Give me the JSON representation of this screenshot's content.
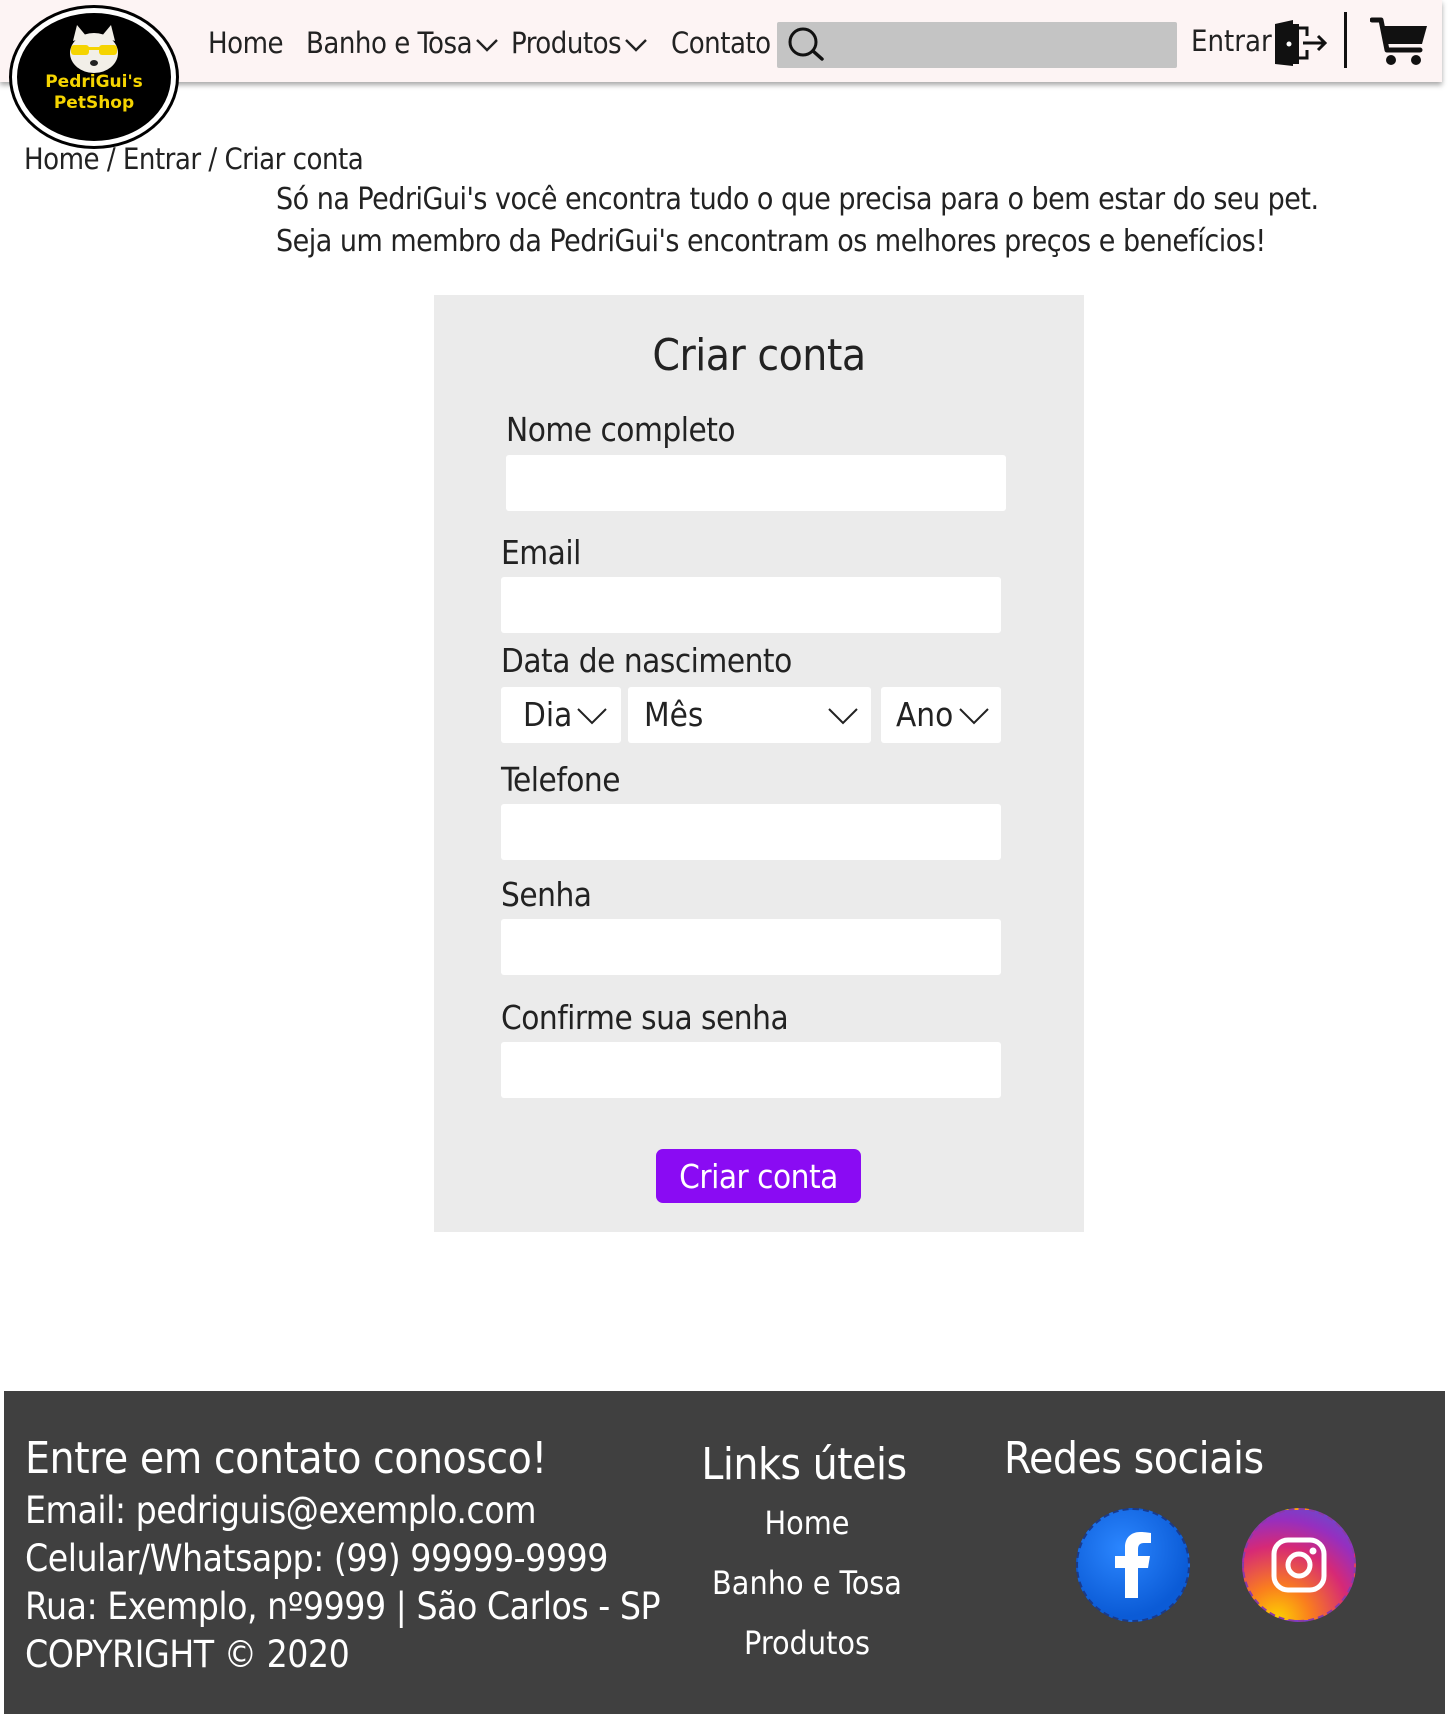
{
  "header": {
    "logo_line1": "PedriGui's",
    "logo_line2": "PetShop",
    "nav": [
      "Home",
      "Banho e Tosa",
      "Produtos",
      "Contato"
    ],
    "search_placeholder": "",
    "login_label": "Entrar",
    "icons": {
      "search": "search-icon",
      "login": "door-exit-icon",
      "cart": "cart-icon",
      "dropdown": "chevron-down-icon"
    }
  },
  "breadcrumb": "Home / Entrar / Criar conta",
  "intro": [
    "Só na PedriGui's você encontra tudo o que precisa para o bem estar do seu pet.",
    "Seja um membro da PedriGui's encontram os melhores preços e benefícios!"
  ],
  "form": {
    "title": "Criar conta",
    "full_name_label": "Nome completo",
    "email_label": "Email",
    "birth_label": "Data de nascimento",
    "day": "Dia",
    "month": "Mês",
    "year": "Ano",
    "phone_label": "Telefone",
    "password_label": "Senha",
    "confirm_label": "Confirme sua senha",
    "submit_label": "Criar conta"
  },
  "footer": {
    "contact_title": "Entre em contato conosco!",
    "contact_lines": [
      "Email: pedriguis@exemplo.com",
      "Celular/Whatsapp: (99) 99999-9999",
      "Rua: Exemplo, nº9999 | São Carlos - SP",
      "COPYRIGHT © 2020"
    ],
    "links_title": "Links úteis",
    "links": [
      "Home",
      "Banho e Tosa",
      "Produtos"
    ],
    "social_title": "Redes sociais",
    "social": [
      "facebook-icon",
      "instagram-icon"
    ]
  },
  "colors": {
    "accent": "#8a0bf3",
    "footer_bg": "#404040",
    "panel_bg": "#ebebeb",
    "header_bg": "#fdf4f4",
    "logo_yellow": "#f5d400"
  }
}
